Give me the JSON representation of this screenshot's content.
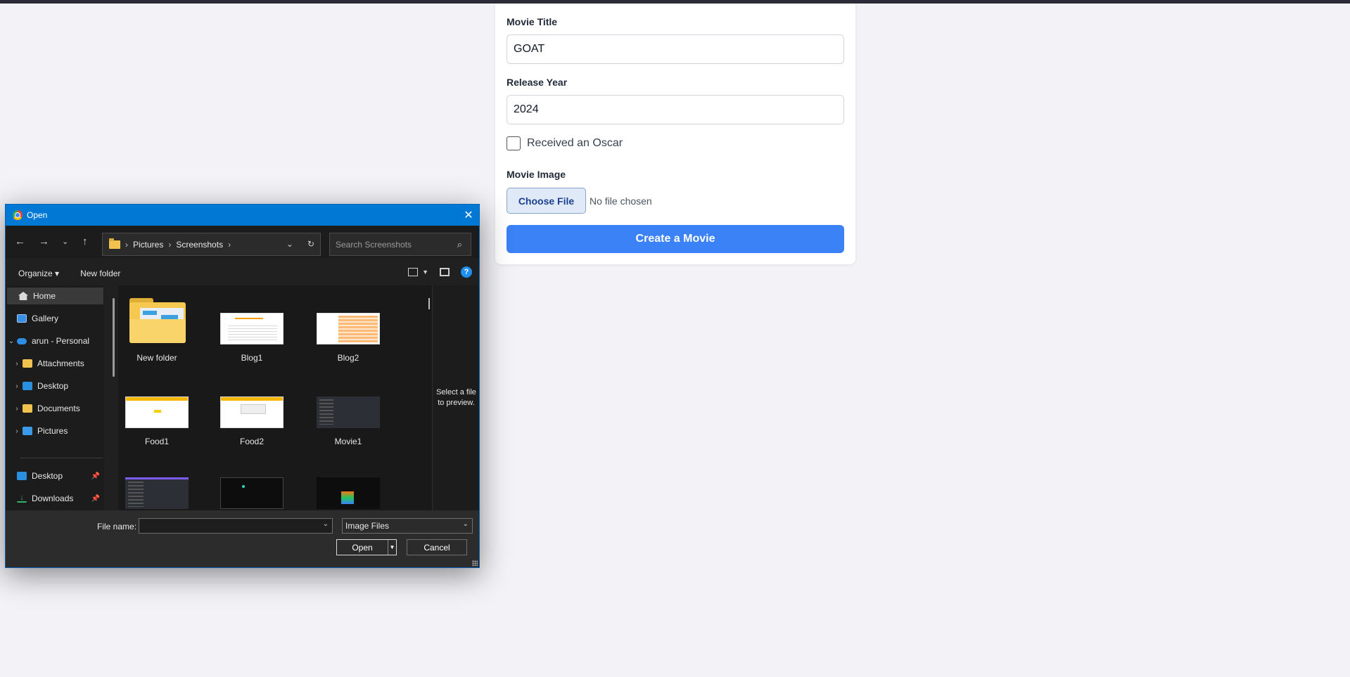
{
  "form": {
    "title_label": "Movie Title",
    "title_value": "GOAT",
    "year_label": "Release Year",
    "year_value": "2024",
    "oscar_label": "Received an Oscar",
    "oscar_checked": false,
    "image_label": "Movie Image",
    "choose_file": "Choose File",
    "no_file": "No file chosen",
    "submit": "Create a Movie"
  },
  "dialog": {
    "title": "Open",
    "address": [
      "Pictures",
      "Screenshots"
    ],
    "search_placeholder": "Search Screenshots",
    "toolbar": {
      "organize": "Organize",
      "new_folder": "New folder"
    },
    "nav": [
      {
        "label": "Home",
        "icon": "home-icon"
      },
      {
        "label": "Gallery",
        "icon": "gallery-icon"
      },
      {
        "label": "arun - Personal",
        "icon": "cloud-icon"
      },
      {
        "label": "Attachments",
        "icon": "folder-icon"
      },
      {
        "label": "Desktop",
        "icon": "desktop-icon"
      },
      {
        "label": "Documents",
        "icon": "folder-icon"
      },
      {
        "label": "Pictures",
        "icon": "pictures-icon"
      },
      {
        "label": "Desktop",
        "icon": "desktop-icon"
      },
      {
        "label": "Downloads",
        "icon": "download-icon"
      }
    ],
    "files": [
      "New folder",
      "Blog1",
      "Blog2",
      "Food1",
      "Food2",
      "Movie1"
    ],
    "preview_text": "Select a file to preview.",
    "file_name_label": "File name:",
    "file_name_value": "",
    "file_type": "Image Files",
    "open_button": "Open",
    "cancel_button": "Cancel"
  },
  "colors": {
    "accent": "#3b82f6",
    "titlebar": "#0078d4",
    "dialog_bg": "#202020"
  }
}
